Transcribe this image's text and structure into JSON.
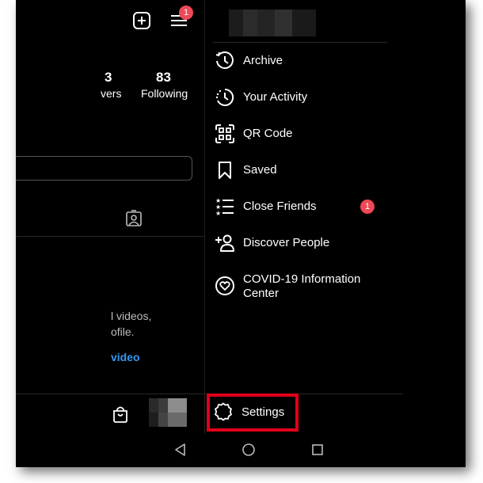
{
  "header": {
    "notification_count": "1"
  },
  "profile": {
    "followers_num_partial": "3",
    "followers_label_partial": "vers",
    "following_num": "83",
    "following_label": "Following",
    "empty_text_line1": "l videos,",
    "empty_text_line2": "ofile.",
    "empty_link": "video"
  },
  "drawer": {
    "items": [
      {
        "label": "Archive",
        "icon": "archive-icon"
      },
      {
        "label": "Your Activity",
        "icon": "activity-icon"
      },
      {
        "label": "QR Code",
        "icon": "qr-code-icon"
      },
      {
        "label": "Saved",
        "icon": "bookmark-icon"
      },
      {
        "label": "Close Friends",
        "icon": "close-friends-icon",
        "badge": "1"
      },
      {
        "label": "Discover People",
        "icon": "add-person-icon"
      },
      {
        "label": "COVID-19 Information",
        "label2": "Center",
        "icon": "covid-info-icon"
      }
    ],
    "settings_label": "Settings"
  },
  "colors": {
    "badge": "#ed4956",
    "highlight": "#e0001a",
    "link": "#3897f0"
  }
}
